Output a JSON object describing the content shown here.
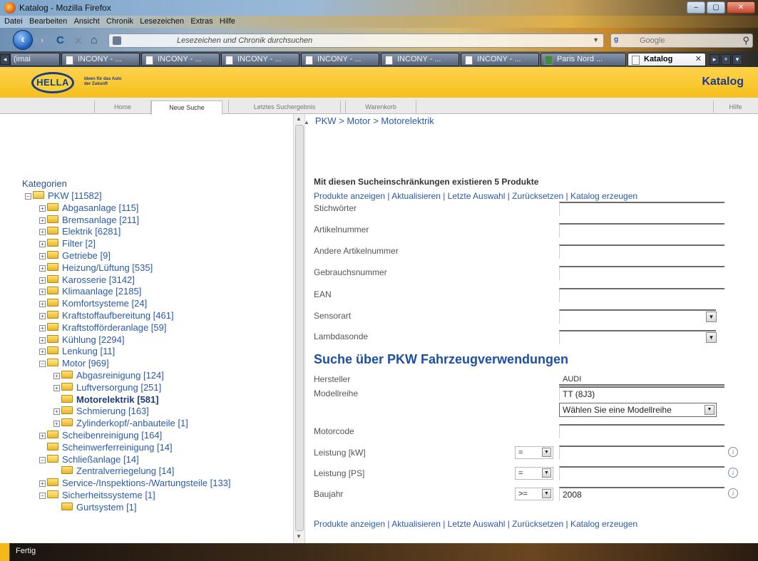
{
  "window": {
    "title": "Katalog - Mozilla Firefox"
  },
  "menu": [
    "Datei",
    "Bearbeiten",
    "Ansicht",
    "Chronik",
    "Lesezeichen",
    "Extras",
    "Hilfe"
  ],
  "urlbar": {
    "placeholder": "Lesezeichen und Chronik durchsuchen"
  },
  "searchbar": {
    "engine": "Google",
    "placeholder": "Google"
  },
  "tabs": [
    {
      "label": "(imai"
    },
    {
      "label": "INCONY - ..."
    },
    {
      "label": "INCONY - ..."
    },
    {
      "label": "INCONY - ..."
    },
    {
      "label": "INCONY - ..."
    },
    {
      "label": "INCONY - ..."
    },
    {
      "label": "INCONY - ..."
    },
    {
      "label": "Paris Nord ..."
    },
    {
      "label": "Katalog"
    }
  ],
  "header": {
    "logo": "HELLA",
    "slogan": "Ideen für das Auto der Zukunft",
    "title": "Katalog"
  },
  "nav": {
    "home": "Home",
    "new_search": "Neue Suche",
    "last_result": "Letztes Suchergebnis",
    "cart": "Warenkorb",
    "help": "Hilfe"
  },
  "breadcrumb": "PKW > Motor > Motorelektrik",
  "categories": {
    "title": "Kategorien",
    "items": [
      {
        "label": "PKW [11582]",
        "level": 0,
        "expander": "-",
        "open": true
      },
      {
        "label": "Abgasanlage [115]",
        "level": 1,
        "expander": "+"
      },
      {
        "label": "Bremsanlage [211]",
        "level": 1,
        "expander": "+"
      },
      {
        "label": "Elektrik [6281]",
        "level": 1,
        "expander": "+"
      },
      {
        "label": "Filter [2]",
        "level": 1,
        "expander": "+"
      },
      {
        "label": "Getriebe [9]",
        "level": 1,
        "expander": "+"
      },
      {
        "label": "Heizung/Lüftung [535]",
        "level": 1,
        "expander": "+"
      },
      {
        "label": "Karosserie [3142]",
        "level": 1,
        "expander": "+"
      },
      {
        "label": "Klimaanlage [2185]",
        "level": 1,
        "expander": "+"
      },
      {
        "label": "Komfortsysteme [24]",
        "level": 1,
        "expander": "+"
      },
      {
        "label": "Kraftstoffaufbereitung [461]",
        "level": 1,
        "expander": "+"
      },
      {
        "label": "Kraftstofförderanlage [59]",
        "level": 1,
        "expander": "+"
      },
      {
        "label": "Kühlung [2294]",
        "level": 1,
        "expander": "+"
      },
      {
        "label": "Lenkung [11]",
        "level": 1,
        "expander": "+"
      },
      {
        "label": "Motor [969]",
        "level": 1,
        "expander": "-",
        "open": true
      },
      {
        "label": "Abgasreinigung [124]",
        "level": 2,
        "expander": "+"
      },
      {
        "label": "Luftversorgung [251]",
        "level": 2,
        "expander": "+"
      },
      {
        "label": "Motorelektrik [581]",
        "level": 2,
        "expander": "",
        "selected": true
      },
      {
        "label": "Schmierung [163]",
        "level": 2,
        "expander": "+"
      },
      {
        "label": "Zylinderkopf/-anbauteile [1]",
        "level": 2,
        "expander": "+"
      },
      {
        "label": "Scheibenreinigung [164]",
        "level": 1,
        "expander": "+"
      },
      {
        "label": "Scheinwerferreinigung [14]",
        "level": 1,
        "expander": ""
      },
      {
        "label": "Schließanlage [14]",
        "level": 1,
        "expander": "-",
        "open": true
      },
      {
        "label": "Zentralverriegelung [14]",
        "level": 2,
        "expander": ""
      },
      {
        "label": "Service-/Inspektions-/Wartungsteile [133]",
        "level": 1,
        "expander": "+"
      },
      {
        "label": "Sicherheitssysteme [1]",
        "level": 1,
        "expander": "-",
        "open": true
      },
      {
        "label": "Gurtsystem [1]",
        "level": 2,
        "expander": ""
      }
    ]
  },
  "search": {
    "info": "Mit diesen Sucheinschränkungen existieren 5 Produkte",
    "links": "Produkte anzeigen | Aktualisieren | Letzte Auswahl | Zurücksetzen | Katalog erzeugen",
    "fields": {
      "stichwoerter": "Stichwörter",
      "artikelnummer": "Artikelnummer",
      "andere_artikelnummer": "Andere Artikelnummer",
      "gebrauchsnummer": "Gebrauchsnummer",
      "ean": "EAN",
      "sensorart": "Sensorart",
      "lambdasonde": "Lambdasonde"
    }
  },
  "vehicle": {
    "section_title": "Suche über PKW Fahrzeugverwendungen",
    "hersteller_label": "Hersteller",
    "hersteller_value": "AUDI",
    "modellreihe_label": "Modellreihe",
    "modellreihe_value": "TT (8J3)",
    "modellreihe_select": "Wählen Sie eine Modellreihe",
    "motorcode_label": "Motorcode",
    "leistung_kw_label": "Leistung [kW]",
    "leistung_kw_op": "=",
    "leistung_ps_label": "Leistung [PS]",
    "leistung_ps_op": "=",
    "baujahr_label": "Baujahr",
    "baujahr_op": ">=",
    "baujahr_value": "2008"
  },
  "status": {
    "text": "Fertig"
  }
}
